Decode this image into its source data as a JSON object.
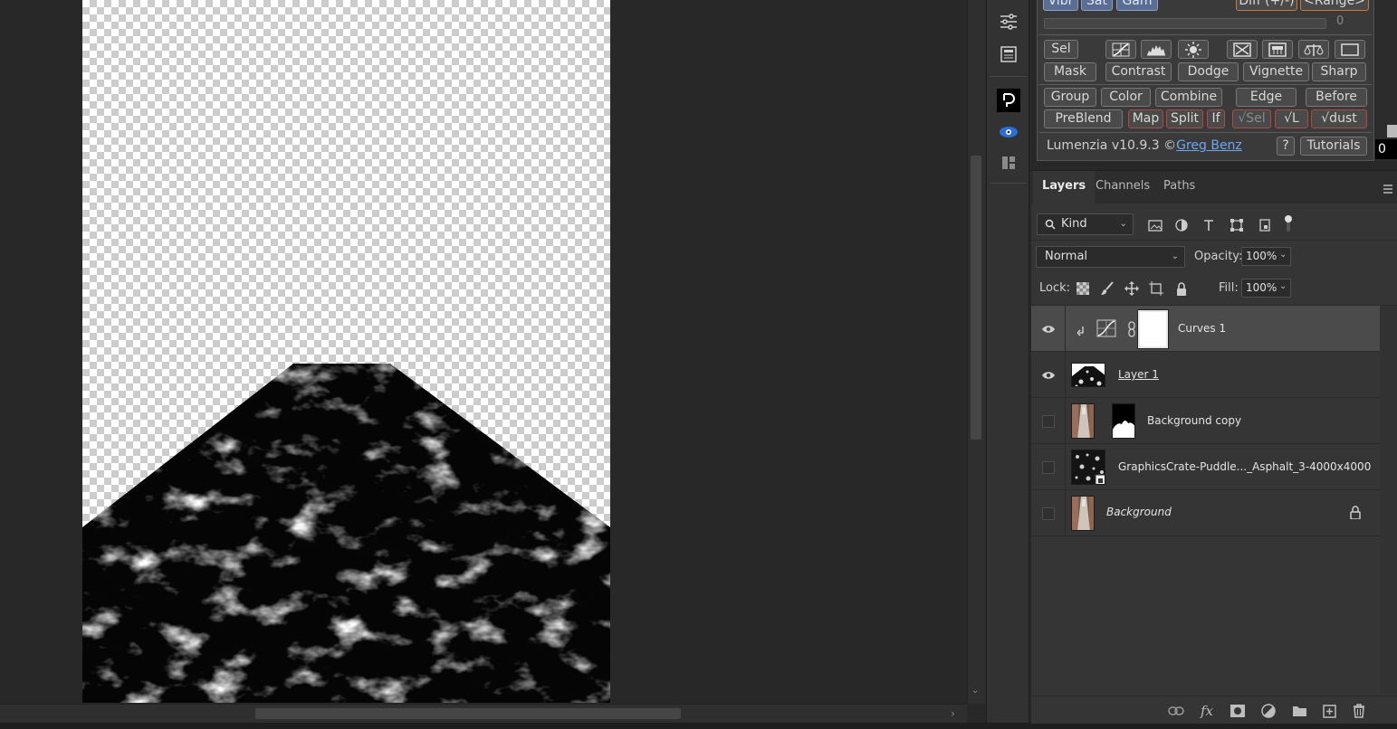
{
  "lumenzia": {
    "row0": {
      "vibr": "Vibr",
      "sat": "Sat",
      "gam": "Gam",
      "diff": "Diff (+/-)",
      "range": "<Range>"
    },
    "slider_value": "0",
    "row1_sel": "Sel",
    "row2": {
      "mask": "Mask",
      "contrast": "Contrast",
      "dodge": "Dodge",
      "vignette": "Vignette",
      "sharp": "Sharp"
    },
    "row3": {
      "group": "Group",
      "color": "Color",
      "combine": "Combine",
      "edge": "Edge",
      "before": "Before"
    },
    "row4": {
      "preblend": "PreBlend",
      "map": "Map",
      "split": "Split",
      "if": "If",
      "vsel": "√Sel",
      "vl": "√L",
      "vdust": "√dust"
    },
    "version": "Lumenzia v10.9.3 ©",
    "author": "Greg Benz",
    "help": "?",
    "tutorials": "Tutorials",
    "side_value": "0"
  },
  "layers_panel": {
    "tabs": [
      "Layers",
      "Channels",
      "Paths"
    ],
    "active_tab": "Layers",
    "filter_kind": "Kind",
    "blend_mode": "Normal",
    "opacity_label": "Opacity:",
    "opacity_value": "100%",
    "lock_label": "Lock:",
    "fill_label": "Fill:",
    "fill_value": "100%",
    "layers": [
      {
        "name": "Curves 1",
        "visible": true,
        "selected": true,
        "type": "adjustment-curves"
      },
      {
        "name": "Layer 1",
        "visible": true,
        "selected": false,
        "type": "pixel"
      },
      {
        "name": "Background copy",
        "visible": false,
        "selected": false,
        "type": "pixel-with-mask"
      },
      {
        "name": "GraphicsCrate-Puddle..._Asphalt_3-4000x4000",
        "visible": false,
        "selected": false,
        "type": "smart-object"
      },
      {
        "name": "Background",
        "visible": false,
        "selected": false,
        "type": "background-locked"
      }
    ]
  },
  "colors": {
    "app_background": "#282828",
    "panel_background": "#353535",
    "selected_layer": "#4b4b4b",
    "lumenzia_blue_button": "#5a6d95",
    "lumenzia_red_border": "#b04848",
    "link_blue": "#6ea7f5"
  },
  "icons": {
    "tool_strip": [
      "adjustments-icon",
      "libraries-icon",
      "dlogo-plugin-icon",
      "eye-plugin-icon",
      "puzzle-plugin-icon"
    ],
    "footer": [
      "link-layers-icon",
      "fx-icon",
      "add-mask-icon",
      "adjustment-layer-icon",
      "new-group-icon",
      "new-layer-icon",
      "delete-layer-icon"
    ]
  }
}
